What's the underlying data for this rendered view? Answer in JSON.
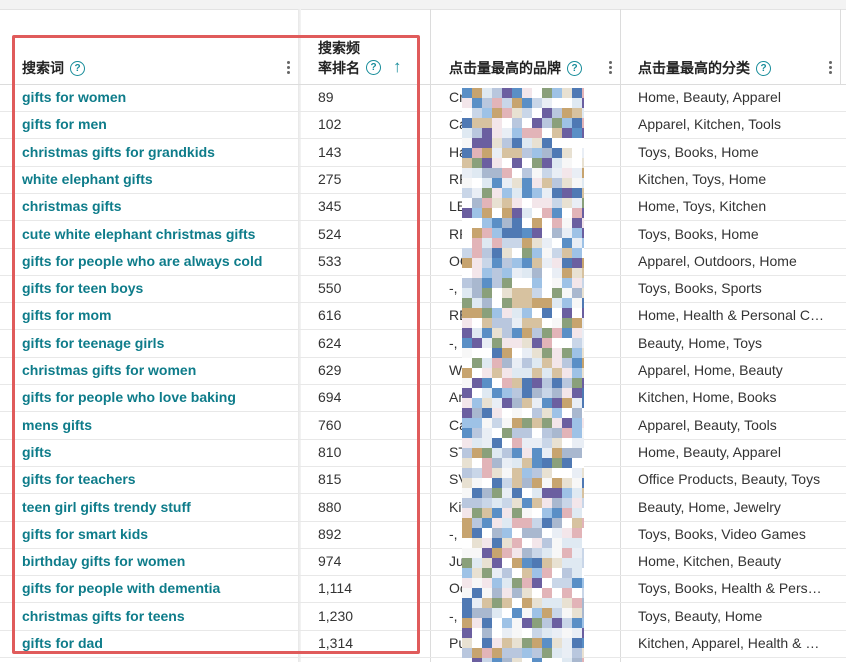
{
  "table": {
    "headers": {
      "keyword": "搜索词",
      "rank_line1": "搜索频",
      "rank_line2": "率排名",
      "brand": "点击量最高的品牌",
      "category": "点击量最高的分类"
    },
    "rows": [
      {
        "keyword": "gifts for women",
        "rank": "89",
        "brand": "Cro… …, S…",
        "category": "Home, Beauty, Apparel"
      },
      {
        "keyword": "gifts for men",
        "rank": "102",
        "brand": "Ca… bli…",
        "category": "Apparel, Kitchen, Tools"
      },
      {
        "keyword": "christmas gifts for grandkids",
        "rank": "143",
        "brand": "Ha… ce…",
        "category": "Toys, Books, Home"
      },
      {
        "keyword": "white elephant gifts",
        "rank": "275",
        "brand": "RP… a, W…",
        "category": "Kitchen, Toys, Home"
      },
      {
        "keyword": "christmas gifts",
        "rank": "345",
        "brand": "LE… CO…",
        "category": "Home, Toys, Kitchen"
      },
      {
        "keyword": "cute white elephant christmas gifts",
        "rank": "524",
        "brand": "RP… XV",
        "category": "Toys, Books, Home"
      },
      {
        "keyword": "gifts for people who are always cold",
        "rank": "533",
        "brand": "OC… E…",
        "category": "Apparel, Outdoors, Home"
      },
      {
        "keyword": "gifts for teen boys",
        "rank": "550",
        "brand": "-, I… ub…",
        "category": "Toys, Books, Sports"
      },
      {
        "keyword": "gifts for mom",
        "rank": "616",
        "brand": "RE… t",
        "category": "Home, Health & Personal C…"
      },
      {
        "keyword": "gifts for teenage girls",
        "rank": "624",
        "brand": "-, k… /",
        "category": "Beauty, Home, Toys"
      },
      {
        "keyword": "christmas gifts for women",
        "rank": "629",
        "brand": "Wi… CN…",
        "category": "Apparel, Home, Beauty"
      },
      {
        "keyword": "gifts for people who love baking",
        "rank": "694",
        "brand": "Am… en…",
        "category": "Kitchen, Home, Books"
      },
      {
        "keyword": "mens gifts",
        "rank": "760",
        "brand": "Ca… ock…",
        "category": "Apparel, Beauty, Tools"
      },
      {
        "keyword": "gifts",
        "rank": "810",
        "brand": "ST… H, L…",
        "category": "Home, Beauty, Apparel"
      },
      {
        "keyword": "gifts for teachers",
        "rank": "815",
        "brand": "SV… play…",
        "category": "Office Products, Beauty, Toys"
      },
      {
        "keyword": "teen girl gifts trendy stuff",
        "rank": "880",
        "brand": "Kit… de J…",
        "category": "Beauty, Home, Jewelry"
      },
      {
        "keyword": "gifts for smart kids",
        "rank": "892",
        "brand": "-, L… un",
        "category": "Toys, Books, Video Games"
      },
      {
        "keyword": "birthday gifts for women",
        "rank": "974",
        "brand": "Ju… TOP, …",
        "category": "Home, Kitchen, Beauty"
      },
      {
        "keyword": "gifts for people with dementia",
        "rank": "1,114",
        "brand": "Oc… COM",
        "category": "Toys, Books, Health & Pers…"
      },
      {
        "keyword": "christmas gifts for teens",
        "rank": "1,230",
        "brand": "-, I… D",
        "category": "Toys, Beauty, Home"
      },
      {
        "keyword": "gifts for dad",
        "rank": "1,314",
        "brand": "Pul… natio…",
        "category": "Kitchen, Apparel, Health & …"
      }
    ]
  },
  "icons": {
    "help": "?",
    "sort": "↑"
  },
  "colors": {
    "keyword_link": "#0e7c8a",
    "icon_accent": "#178c9a",
    "highlight_box": "#e05b5b",
    "divider": "#dcdcdc"
  }
}
